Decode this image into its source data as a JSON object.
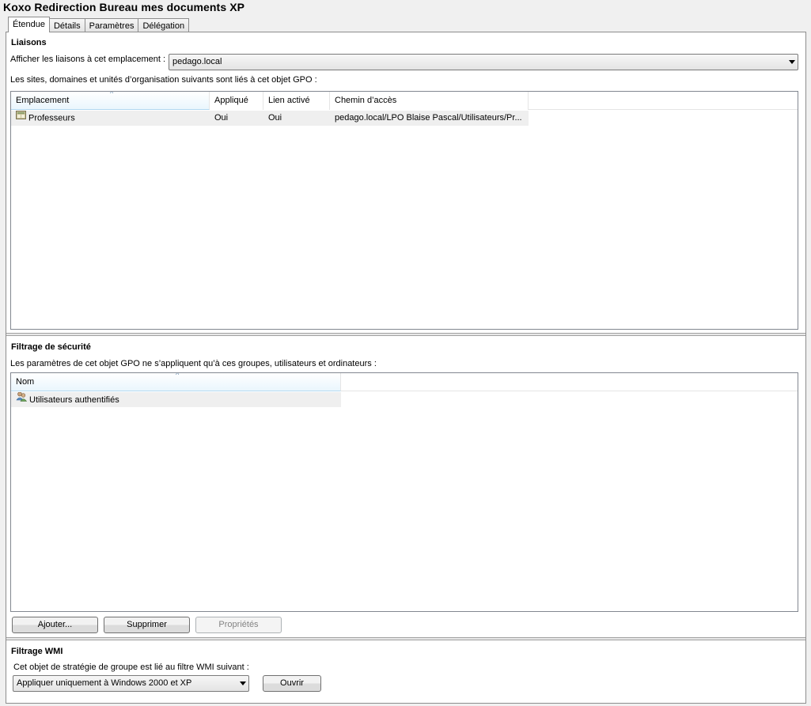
{
  "window": {
    "title": "Koxo Redirection Bureau mes documents XP"
  },
  "tabs": [
    {
      "label": "Étendue"
    },
    {
      "label": "Détails"
    },
    {
      "label": "Paramètres"
    },
    {
      "label": "Délégation"
    }
  ],
  "links": {
    "section_title": "Liaisons",
    "show_links_label": "Afficher les liaisons à cet emplacement :",
    "location_combo_value": "pedago.local",
    "description": "Les sites, domaines et unités d’organisation suivants sont liés à cet objet GPO :",
    "columns": [
      "Emplacement",
      "Appliqué",
      "Lien activé",
      "Chemin d’accès"
    ],
    "rows": [
      {
        "location": "Professeurs",
        "applied": "Oui",
        "link_enabled": "Oui",
        "path": "pedago.local/LPO Blaise Pascal/Utilisateurs/Pr..."
      }
    ]
  },
  "security_filtering": {
    "section_title": "Filtrage de sécurité",
    "description": "Les paramètres de cet objet GPO ne s’appliquent qu’à ces groupes, utilisateurs et ordinateurs :",
    "columns": [
      "Nom"
    ],
    "rows": [
      {
        "name": "Utilisateurs authentifiés"
      }
    ],
    "buttons": {
      "add": "Ajouter...",
      "remove": "Supprimer",
      "properties": "Propriétés"
    }
  },
  "wmi_filtering": {
    "section_title": "Filtrage WMI",
    "description": "Cet objet de stratégie de groupe est lié au filtre WMI suivant :",
    "filter_value": "Appliquer uniquement à Windows 2000 et XP",
    "open_button": "Ouvrir"
  }
}
